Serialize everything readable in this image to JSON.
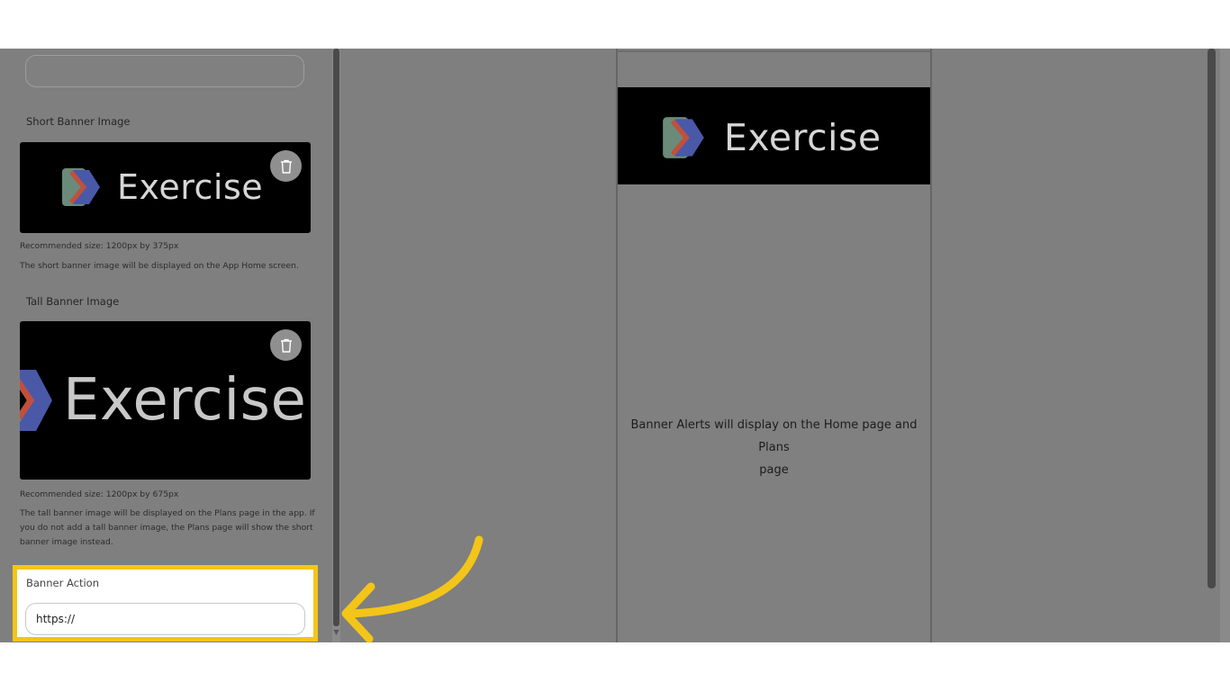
{
  "left_panel": {
    "short_banner": {
      "label": "Short Banner Image",
      "image_text": "Exercise",
      "rec_size": "Recommended size: 1200px by 375px",
      "description": "The short banner image will be displayed on the App Home screen."
    },
    "tall_banner": {
      "label": "Tall Banner Image",
      "image_text": "Exercise",
      "rec_size": "Recommended size: 1200px by 675px",
      "description_lines": [
        "The tall banner image will be displayed on the Plans page in the app. If",
        "you do not add a tall banner image, the Plans page will show the short",
        "banner image instead."
      ]
    },
    "banner_action": {
      "label": "Banner Action",
      "value": "https://"
    }
  },
  "preview": {
    "banner_text": "Exercise",
    "message_line1": "Banner Alerts will display on the Home page and Plans",
    "message_line2": "page"
  },
  "colors": {
    "highlight": "#f3c518",
    "overlay": "#7f7f7f"
  }
}
